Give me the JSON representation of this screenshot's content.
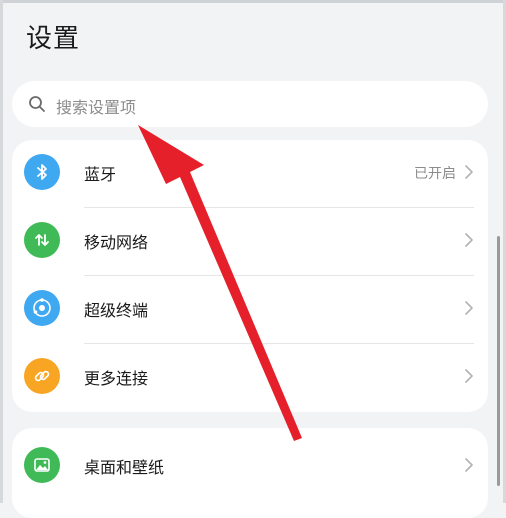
{
  "header": {
    "title": "设置"
  },
  "search": {
    "placeholder": "搜索设置项"
  },
  "groups": [
    {
      "items": [
        {
          "label": "蓝牙",
          "value": "已开启",
          "icon": "bluetooth-icon",
          "color": "#3ea8f1"
        },
        {
          "label": "移动网络",
          "value": "",
          "icon": "mobile-data-icon",
          "color": "#3fba57"
        },
        {
          "label": "超级终端",
          "value": "",
          "icon": "super-device-icon",
          "color": "#3ea8f1"
        },
        {
          "label": "更多连接",
          "value": "",
          "icon": "link-icon",
          "color": "#f9a524"
        }
      ]
    },
    {
      "items": [
        {
          "label": "桌面和壁纸",
          "value": "",
          "icon": "wallpaper-icon",
          "color": "#3fba57"
        }
      ]
    }
  ],
  "annotation": {
    "type": "arrow",
    "color": "#e5202a"
  }
}
